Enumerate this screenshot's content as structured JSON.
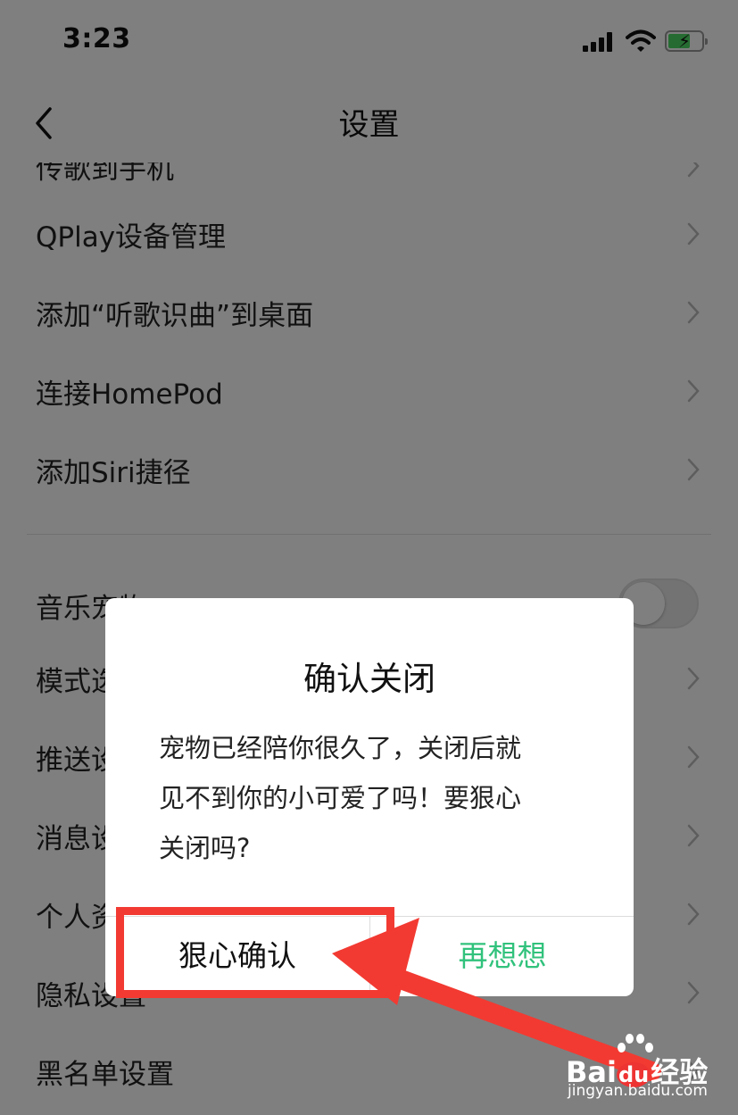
{
  "status_bar": {
    "time": "3:23"
  },
  "nav": {
    "title": "设置"
  },
  "settings": {
    "items": [
      {
        "label": "传歌到手机"
      },
      {
        "label": "QPlay设备管理"
      },
      {
        "label": "添加“听歌识曲”到桌面"
      },
      {
        "label": "连接HomePod"
      },
      {
        "label": "添加Siri捷径"
      }
    ],
    "items2": [
      {
        "label": "音乐宠物"
      },
      {
        "label": "模式选择"
      },
      {
        "label": "推送设置"
      },
      {
        "label": "消息设置"
      },
      {
        "label": "个人资料"
      },
      {
        "label": "隐私设置"
      },
      {
        "label": "黑名单设置"
      }
    ],
    "music_pet_toggle": "off"
  },
  "dialog": {
    "title": "确认关闭",
    "message_lines": [
      "宠物已经陪你很久了，关闭后就",
      "见不到你的小可爱了吗！要狠心",
      "关闭吗?"
    ],
    "confirm_label": "狠心确认",
    "cancel_label": "再想想"
  },
  "colors": {
    "accent_green": "#31c27c",
    "annotation_red": "#f23a32",
    "battery_green": "#4cd964"
  },
  "watermark": {
    "brand_pre": "Bai",
    "brand_du": "du",
    "brand_post": "经验",
    "url": "jingyan.baidu.com"
  }
}
